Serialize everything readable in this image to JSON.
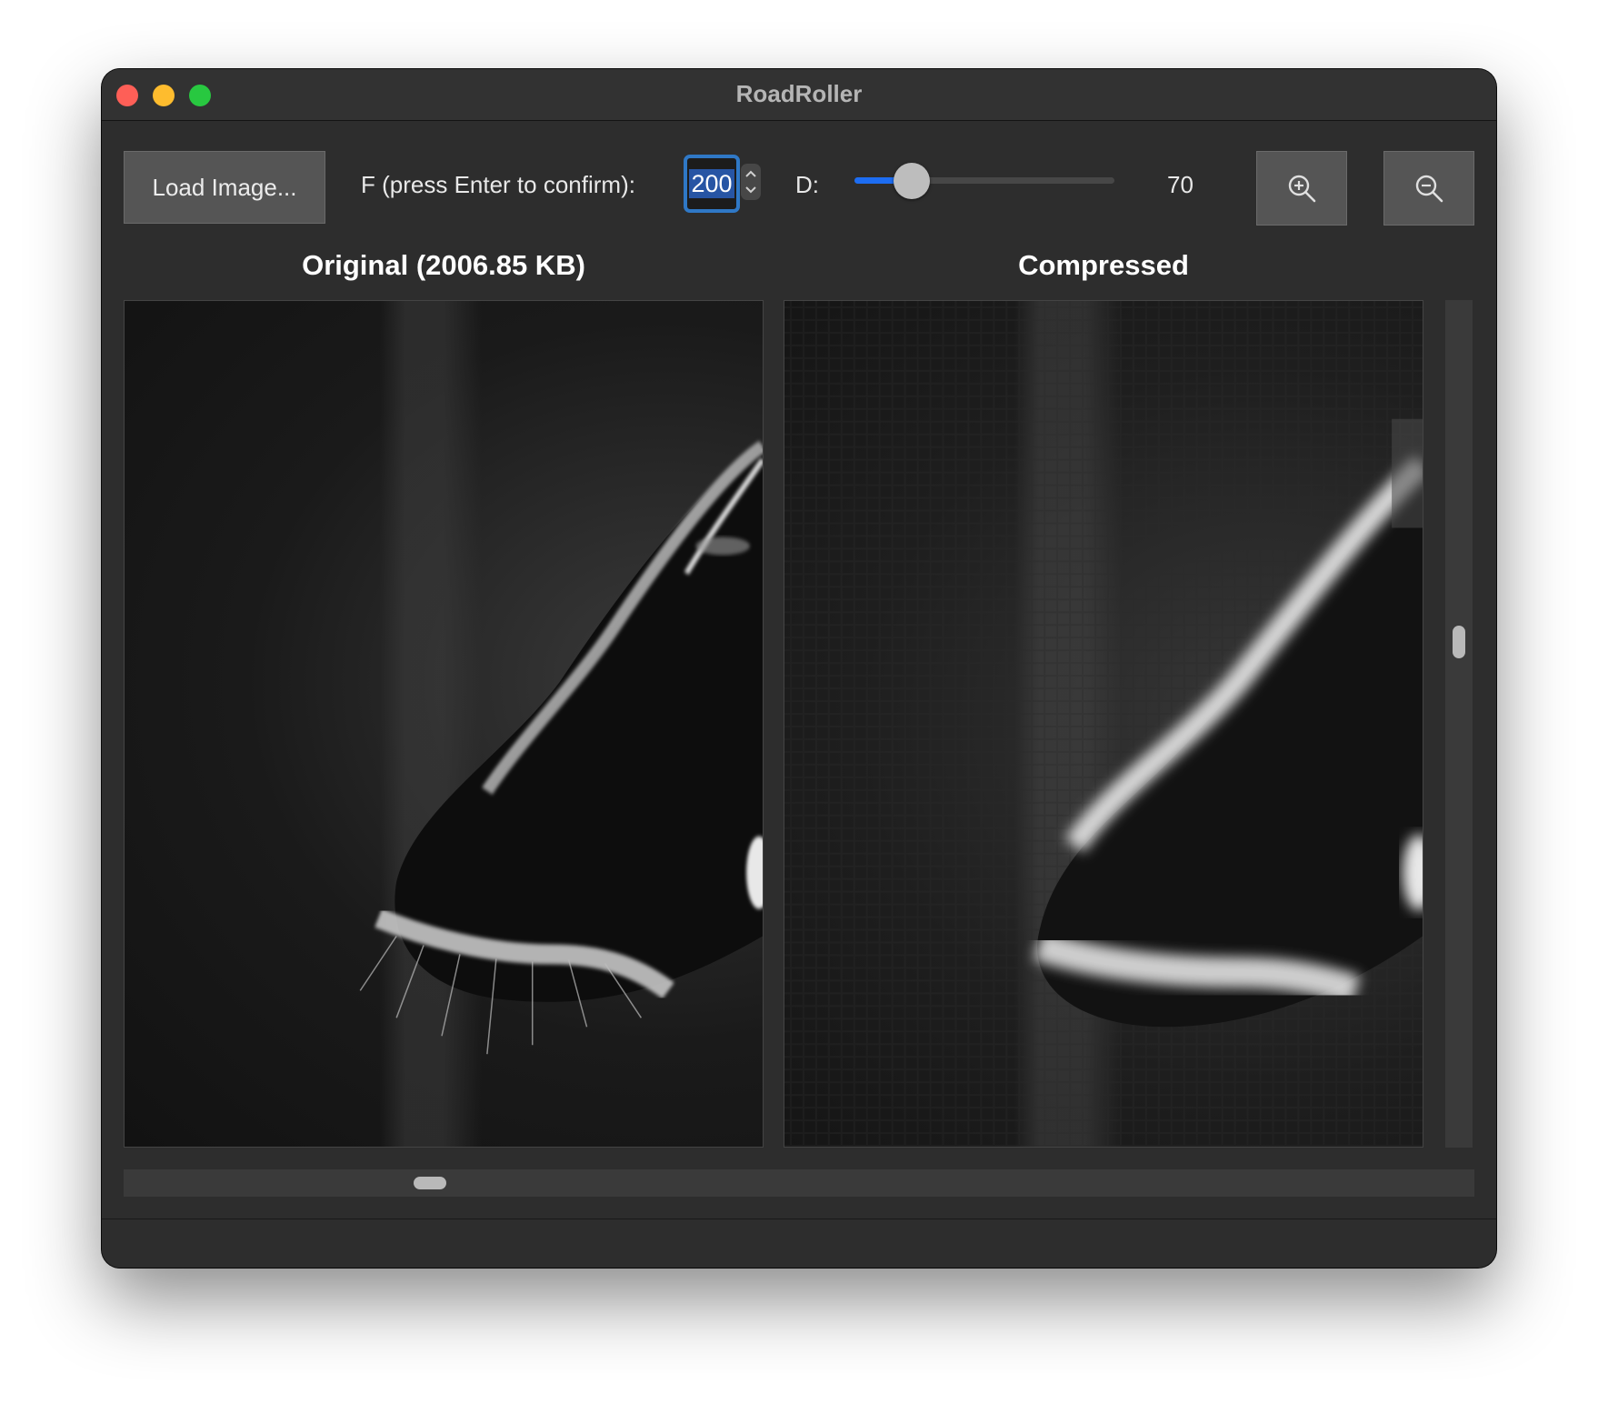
{
  "window": {
    "title": "RoadRoller"
  },
  "toolbar": {
    "load_label": "Load Image...",
    "f_label": "F (press Enter to confirm):",
    "f_value": "200",
    "d_label": "D:",
    "d_value": "70",
    "d_slider_fraction": 0.22,
    "zoom_in_icon": "zoom-in-icon",
    "zoom_out_icon": "zoom-out-icon"
  },
  "panels": {
    "original_title": "Original (2006.85 KB)",
    "compressed_title": "Compressed"
  },
  "scrollbars": {
    "vertical_fraction": 0.4,
    "horizontal_fraction": 0.22
  },
  "colors": {
    "accent": "#1d6df2",
    "focus_ring": "#2f78c6",
    "window_bg": "#2d2d2d"
  }
}
